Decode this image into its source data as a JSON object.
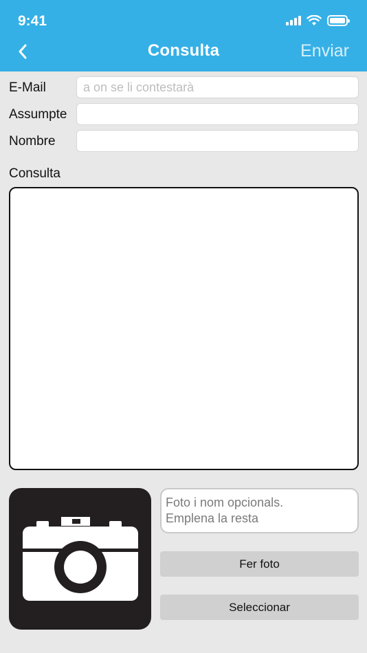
{
  "status_bar": {
    "time": "9:41"
  },
  "nav": {
    "title": "Consulta",
    "send_label": "Enviar"
  },
  "form": {
    "email_label": "E-Mail",
    "email_placeholder": "a on se li contestarà",
    "email_value": "",
    "subject_label": "Assumpte",
    "subject_value": "",
    "name_label": "Nombre",
    "name_value": "",
    "query_label": "Consulta",
    "query_value": ""
  },
  "photo": {
    "icon": "camera-icon",
    "note_line1": "Foto i nom opcionals.",
    "note_line2": "Emplena la resta",
    "take_photo_label": "Fer foto",
    "select_label": "Seleccionar"
  },
  "colors": {
    "header": "#35b0e6",
    "background": "#e8e8e8",
    "photo_bg": "#231f20"
  }
}
